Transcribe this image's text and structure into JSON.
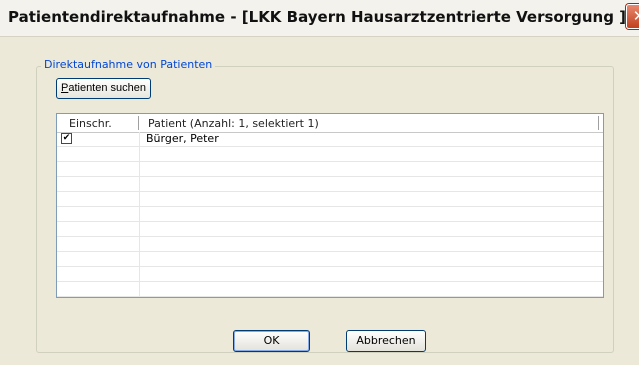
{
  "window": {
    "title": "Patientendirektaufnahme - [LKK Bayern Hausarztzentrierte Versorgung ]",
    "close_symbol": "✕"
  },
  "group": {
    "legend": "Direktaufnahme von Patienten"
  },
  "search_button": {
    "mnemonic": "P",
    "label_rest": "atienten suchen"
  },
  "table": {
    "columns": [
      "Einschr.",
      "Patient (Anzahl: 1, selektiert 1)"
    ],
    "rows": [
      {
        "enrolled": true,
        "patient": "Bürger,  Peter"
      }
    ]
  },
  "buttons": {
    "ok": "OK",
    "cancel": "Abbrechen"
  },
  "icons": {
    "close": "close-icon",
    "checkbox": "checkbox-checked-icon"
  }
}
